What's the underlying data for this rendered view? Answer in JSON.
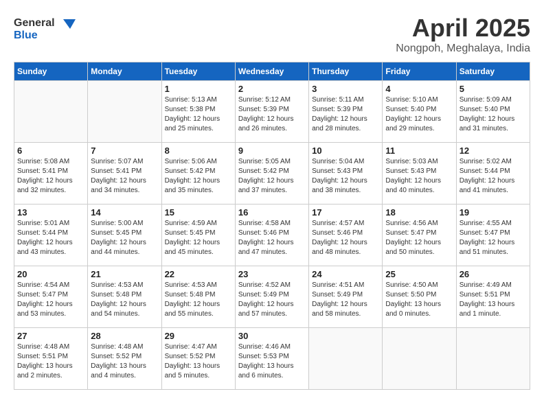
{
  "logo": {
    "line1": "General",
    "line2": "Blue"
  },
  "title": "April 2025",
  "location": "Nongpoh, Meghalaya, India",
  "weekdays": [
    "Sunday",
    "Monday",
    "Tuesday",
    "Wednesday",
    "Thursday",
    "Friday",
    "Saturday"
  ],
  "weeks": [
    [
      {
        "day": "",
        "detail": ""
      },
      {
        "day": "",
        "detail": ""
      },
      {
        "day": "1",
        "detail": "Sunrise: 5:13 AM\nSunset: 5:38 PM\nDaylight: 12 hours\nand 25 minutes."
      },
      {
        "day": "2",
        "detail": "Sunrise: 5:12 AM\nSunset: 5:39 PM\nDaylight: 12 hours\nand 26 minutes."
      },
      {
        "day": "3",
        "detail": "Sunrise: 5:11 AM\nSunset: 5:39 PM\nDaylight: 12 hours\nand 28 minutes."
      },
      {
        "day": "4",
        "detail": "Sunrise: 5:10 AM\nSunset: 5:40 PM\nDaylight: 12 hours\nand 29 minutes."
      },
      {
        "day": "5",
        "detail": "Sunrise: 5:09 AM\nSunset: 5:40 PM\nDaylight: 12 hours\nand 31 minutes."
      }
    ],
    [
      {
        "day": "6",
        "detail": "Sunrise: 5:08 AM\nSunset: 5:41 PM\nDaylight: 12 hours\nand 32 minutes."
      },
      {
        "day": "7",
        "detail": "Sunrise: 5:07 AM\nSunset: 5:41 PM\nDaylight: 12 hours\nand 34 minutes."
      },
      {
        "day": "8",
        "detail": "Sunrise: 5:06 AM\nSunset: 5:42 PM\nDaylight: 12 hours\nand 35 minutes."
      },
      {
        "day": "9",
        "detail": "Sunrise: 5:05 AM\nSunset: 5:42 PM\nDaylight: 12 hours\nand 37 minutes."
      },
      {
        "day": "10",
        "detail": "Sunrise: 5:04 AM\nSunset: 5:43 PM\nDaylight: 12 hours\nand 38 minutes."
      },
      {
        "day": "11",
        "detail": "Sunrise: 5:03 AM\nSunset: 5:43 PM\nDaylight: 12 hours\nand 40 minutes."
      },
      {
        "day": "12",
        "detail": "Sunrise: 5:02 AM\nSunset: 5:44 PM\nDaylight: 12 hours\nand 41 minutes."
      }
    ],
    [
      {
        "day": "13",
        "detail": "Sunrise: 5:01 AM\nSunset: 5:44 PM\nDaylight: 12 hours\nand 43 minutes."
      },
      {
        "day": "14",
        "detail": "Sunrise: 5:00 AM\nSunset: 5:45 PM\nDaylight: 12 hours\nand 44 minutes."
      },
      {
        "day": "15",
        "detail": "Sunrise: 4:59 AM\nSunset: 5:45 PM\nDaylight: 12 hours\nand 45 minutes."
      },
      {
        "day": "16",
        "detail": "Sunrise: 4:58 AM\nSunset: 5:46 PM\nDaylight: 12 hours\nand 47 minutes."
      },
      {
        "day": "17",
        "detail": "Sunrise: 4:57 AM\nSunset: 5:46 PM\nDaylight: 12 hours\nand 48 minutes."
      },
      {
        "day": "18",
        "detail": "Sunrise: 4:56 AM\nSunset: 5:47 PM\nDaylight: 12 hours\nand 50 minutes."
      },
      {
        "day": "19",
        "detail": "Sunrise: 4:55 AM\nSunset: 5:47 PM\nDaylight: 12 hours\nand 51 minutes."
      }
    ],
    [
      {
        "day": "20",
        "detail": "Sunrise: 4:54 AM\nSunset: 5:47 PM\nDaylight: 12 hours\nand 53 minutes."
      },
      {
        "day": "21",
        "detail": "Sunrise: 4:53 AM\nSunset: 5:48 PM\nDaylight: 12 hours\nand 54 minutes."
      },
      {
        "day": "22",
        "detail": "Sunrise: 4:53 AM\nSunset: 5:48 PM\nDaylight: 12 hours\nand 55 minutes."
      },
      {
        "day": "23",
        "detail": "Sunrise: 4:52 AM\nSunset: 5:49 PM\nDaylight: 12 hours\nand 57 minutes."
      },
      {
        "day": "24",
        "detail": "Sunrise: 4:51 AM\nSunset: 5:49 PM\nDaylight: 12 hours\nand 58 minutes."
      },
      {
        "day": "25",
        "detail": "Sunrise: 4:50 AM\nSunset: 5:50 PM\nDaylight: 13 hours\nand 0 minutes."
      },
      {
        "day": "26",
        "detail": "Sunrise: 4:49 AM\nSunset: 5:51 PM\nDaylight: 13 hours\nand 1 minute."
      }
    ],
    [
      {
        "day": "27",
        "detail": "Sunrise: 4:48 AM\nSunset: 5:51 PM\nDaylight: 13 hours\nand 2 minutes."
      },
      {
        "day": "28",
        "detail": "Sunrise: 4:48 AM\nSunset: 5:52 PM\nDaylight: 13 hours\nand 4 minutes."
      },
      {
        "day": "29",
        "detail": "Sunrise: 4:47 AM\nSunset: 5:52 PM\nDaylight: 13 hours\nand 5 minutes."
      },
      {
        "day": "30",
        "detail": "Sunrise: 4:46 AM\nSunset: 5:53 PM\nDaylight: 13 hours\nand 6 minutes."
      },
      {
        "day": "",
        "detail": ""
      },
      {
        "day": "",
        "detail": ""
      },
      {
        "day": "",
        "detail": ""
      }
    ]
  ]
}
